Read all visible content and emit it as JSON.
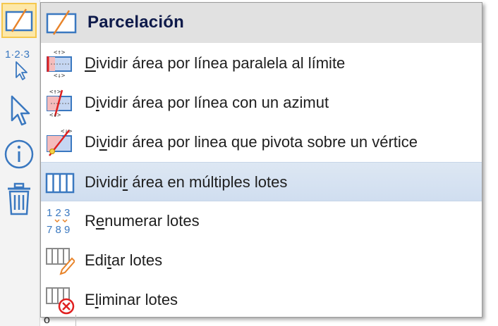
{
  "menu": {
    "title": "Parcelación",
    "items": [
      {
        "pre": "",
        "key": "D",
        "post": "ividir área por línea paralela al límite",
        "icon": "parallel-split-icon"
      },
      {
        "pre": "D",
        "key": "i",
        "post": "vidir área por línea con un azimut",
        "icon": "azimuth-split-icon"
      },
      {
        "pre": "Di",
        "key": "v",
        "post": "idir área por linea que pivota sobre un vértice",
        "icon": "pivot-split-icon"
      },
      {
        "pre": "Dividi",
        "key": "r",
        "post": " área en múltiples lotes",
        "icon": "multiple-lots-icon"
      },
      {
        "pre": "R",
        "key": "e",
        "post": "numerar lotes",
        "icon": "renumber-icon"
      },
      {
        "pre": "Edi",
        "key": "t",
        "post": "ar lotes",
        "icon": "edit-lots-icon"
      },
      {
        "pre": "E",
        "key": "l",
        "post": "iminar lotes",
        "icon": "delete-lots-icon"
      }
    ],
    "hovered_index": 3
  },
  "toolbar": {
    "buttons": [
      "parcel-tool-icon",
      "numbering-tool-icon",
      "pointer-icon",
      "info-icon",
      "trash-icon"
    ],
    "active_index": 0
  },
  "renumber_icon_text": {
    "top": "1 2 3",
    "bottom": "7 8 9"
  },
  "numbering_icon_text": "1·2·3",
  "colors": {
    "accent": "#3a78c0",
    "orange": "#e8842a",
    "red": "#e02020",
    "hover": "#d6e2f1",
    "header": "#e1e1e1"
  }
}
